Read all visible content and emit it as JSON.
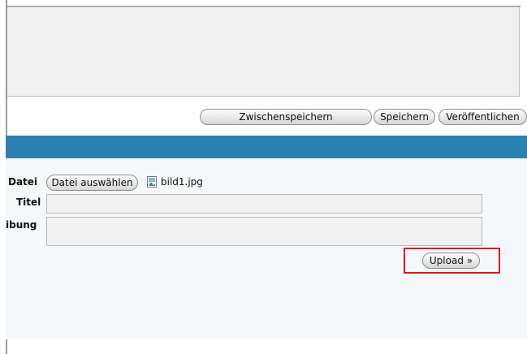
{
  "toolbar": {
    "intermediate_save_label": "Zwischenspeichern",
    "save_label": "Speichern",
    "publish_label": "Veröffentlichen"
  },
  "upload_form": {
    "file_label": "Datei",
    "choose_file_label": "Datei auswählen",
    "selected_file_name": "bild1.jpg",
    "file_icon": "image-file-icon",
    "title_label": "Titel",
    "title_value": "",
    "description_label": "ibung",
    "description_value": "",
    "upload_label": "Upload »"
  },
  "colors": {
    "section_bar": "#2b82b0",
    "highlight_box": "#e01818"
  }
}
